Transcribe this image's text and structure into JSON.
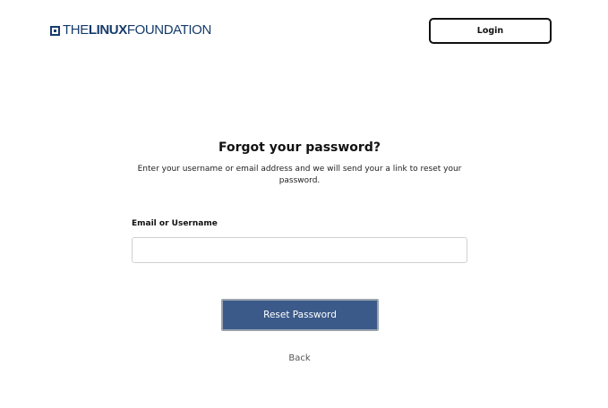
{
  "header": {
    "logo": {
      "prefix": "THE",
      "brand": "LINUX",
      "suffix": "FOUNDATION",
      "color": "#163c6b",
      "icon": "linux-foundation-mark-icon"
    },
    "login_label": "Login"
  },
  "form": {
    "title": "Forgot your password?",
    "subtitle": "Enter your username or email address and we will send your a link to reset your password.",
    "field_label": "Email or Username",
    "field_value": "",
    "field_placeholder": "",
    "submit_label": "Reset Password",
    "submit_color": "#3b5a8a",
    "back_label": "Back"
  }
}
